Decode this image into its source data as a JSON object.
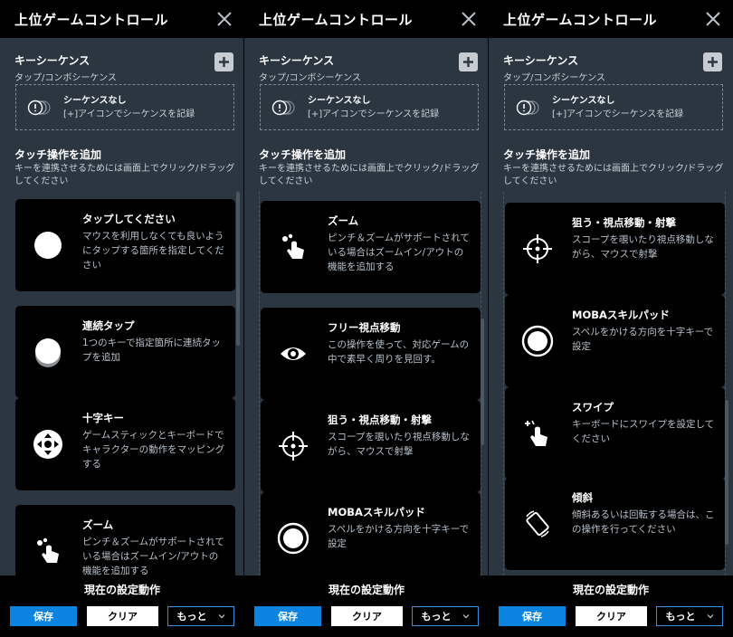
{
  "window_title": "上位ゲームコントロール",
  "sequence": {
    "title": "キーシーケンス",
    "subtitle": "タップ/コンボシーケンス",
    "empty_title": "シーケンスなし",
    "empty_hint": "[+]アイコンでシーケンスを記録"
  },
  "touch": {
    "title": "タッチ操作を追加",
    "subtitle": "キーを連携させるためには画面上でクリック/ドラッグしてください"
  },
  "controls": {
    "tap": {
      "title": "タップしてください",
      "desc": "マウスを利用しなくても良いようにタップする箇所を指定してください",
      "icon": "tap-circle-icon"
    },
    "repeat": {
      "title": "連続タップ",
      "desc": "1つのキーで指定箇所に連続タップを追加",
      "icon": "repeat-tap-icon"
    },
    "dpad": {
      "title": "十字キー",
      "desc": "ゲームスティックとキーボードでキャラクターの動作をマッピングする",
      "icon": "dpad-icon"
    },
    "zoom": {
      "title": "ズーム",
      "desc": "ピンチ＆ズームがサポートされている場合はズームイン/アウトの機能を追加する",
      "icon": "pinch-zoom-icon"
    },
    "freelook": {
      "title": "フリー視点移動",
      "desc": "この操作を使って、対応ゲームの中で素早く周りを見回す。",
      "icon": "eye-icon"
    },
    "aim": {
      "title": "狙う・視点移動・射撃",
      "desc": "スコープを覗いたり視点移動しながら、マウスで射撃",
      "icon": "crosshair-icon"
    },
    "moba": {
      "title": "MOBAスキルパッド",
      "desc": "スペルをかける方向を十字キーで設定",
      "icon": "moba-pad-icon"
    },
    "swipe": {
      "title": "スワイプ",
      "desc": "キーボードにスワイプを設定してください",
      "icon": "swipe-icon"
    },
    "tilt": {
      "title": "傾斜",
      "desc": "傾斜あるいは回転する場合は、この操作を行ってください",
      "icon": "tilt-icon"
    }
  },
  "footer": {
    "title": "現在の設定動作",
    "save_label": "保存",
    "clear_label": "クリア",
    "more_label": "もっと"
  },
  "colors": {
    "panel_bg": "#2b3640",
    "card_bg": "#000000",
    "accent": "#0a84e0"
  }
}
